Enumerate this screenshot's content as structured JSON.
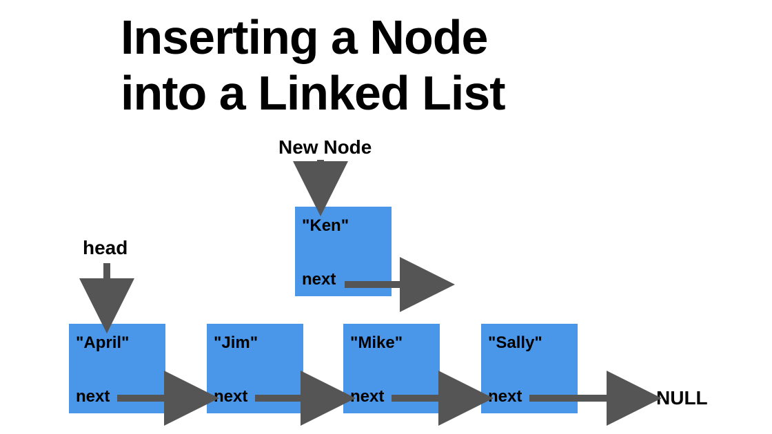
{
  "title_line1": "Inserting a Node",
  "title_line2": "into a Linked List",
  "labels": {
    "head": "head",
    "new_node": "New Node",
    "null": "NULL"
  },
  "nodes": {
    "new": {
      "name": "\"Ken\"",
      "next": "next"
    },
    "n0": {
      "name": "\"April\"",
      "next": "next"
    },
    "n1": {
      "name": "\"Jim\"",
      "next": "next"
    },
    "n2": {
      "name": "\"Mike\"",
      "next": "next"
    },
    "n3": {
      "name": "\"Sally\"",
      "next": "next"
    }
  },
  "colors": {
    "node_fill": "#4a96e8",
    "arrow": "#555555"
  }
}
